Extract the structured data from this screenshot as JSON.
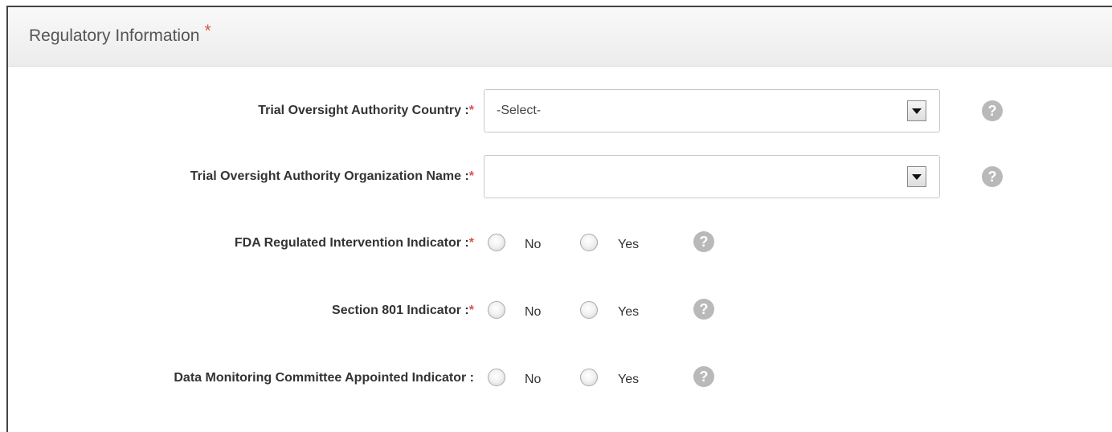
{
  "panel": {
    "title": "Regulatory Information",
    "title_required": "*"
  },
  "fields": {
    "country": {
      "label": "Trial Oversight Authority Country :",
      "required": "*",
      "value": "-Select-",
      "help": "?"
    },
    "org_name": {
      "label": "Trial Oversight Authority Organization Name :",
      "required": "*",
      "value": "",
      "help": "?"
    },
    "fda": {
      "label": "FDA Regulated Intervention Indicator :",
      "required": "*",
      "option_no": "No",
      "option_yes": "Yes",
      "help": "?"
    },
    "section801": {
      "label": "Section 801 Indicator :",
      "required": "*",
      "option_no": "No",
      "option_yes": "Yes",
      "help": "?"
    },
    "dmc": {
      "label": "Data Monitoring Committee Appointed Indicator :",
      "required": "",
      "option_no": "No",
      "option_yes": "Yes",
      "help": "?"
    }
  },
  "colors": {
    "required": "#d9534f",
    "help_icon": "#b9b9b9"
  }
}
